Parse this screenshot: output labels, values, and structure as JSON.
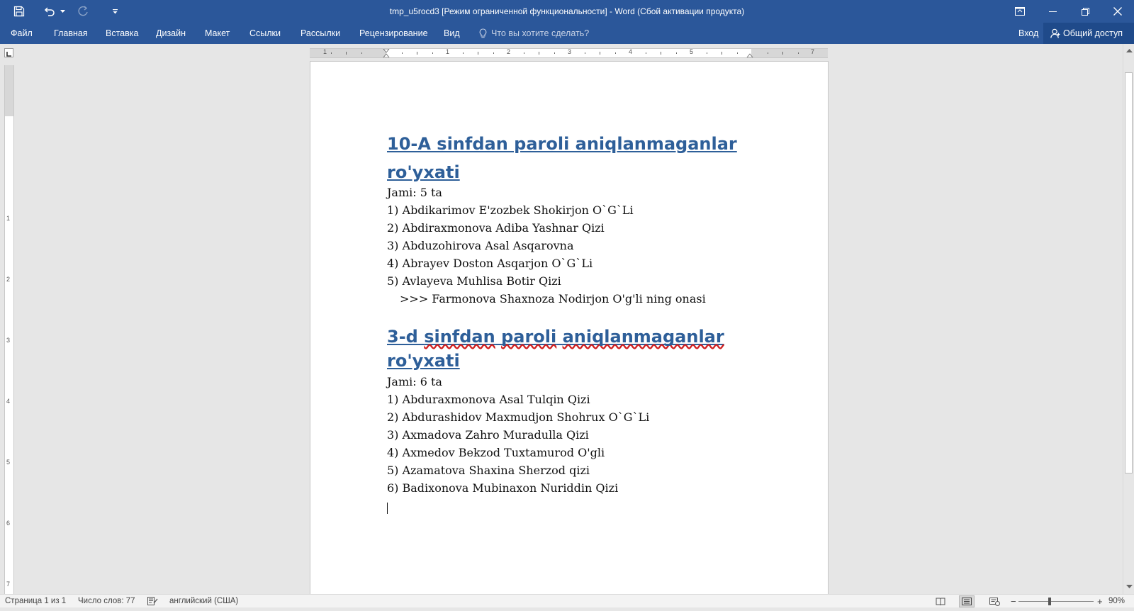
{
  "window": {
    "title": "tmp_u5rocd3 [Режим ограниченной функциональности] - Word (Сбой активации продукта)",
    "qat_icons": [
      "save-icon",
      "undo-icon",
      "redo-icon",
      "customize-qat-icon"
    ],
    "controls": [
      "ribbon-display-options-icon",
      "minimize-icon",
      "restore-icon",
      "close-icon"
    ]
  },
  "ribbon": {
    "tabs": [
      "Файл",
      "Главная",
      "Вставка",
      "Дизайн",
      "Макет",
      "Ссылки",
      "Рассылки",
      "Рецензирование",
      "Вид"
    ],
    "tell_me": "Что вы хотите сделать?",
    "login": "Вход",
    "share": "Общий доступ"
  },
  "ruler": {
    "h_numbers": [
      "1",
      "1",
      "2",
      "3",
      "4",
      "5",
      "7"
    ],
    "v_numbers": [
      "1",
      "2",
      "3",
      "4",
      "5",
      "6",
      "7"
    ]
  },
  "document": {
    "section1": {
      "heading_line1": "10-A sinfdan paroli aniqlanmaganlar",
      "heading_line2": "ro'yxati",
      "total": "Jami: 5 ta",
      "items": [
        "1) Abdikarimov E'zozbek Shokirjon O`G`Li",
        "2) Abdiraxmonova Adiba Yashnar Qizi",
        "3) Abduzohirova Asal Asqarovna",
        "4) Abrayev Doston Asqarjon O`G`Li",
        "5) Avlayeva Muhlisa Botir Qizi"
      ],
      "note": ">>> Farmonova Shaxnoza Nodirjon O'g'li ning onasi"
    },
    "section2": {
      "heading_parts": [
        "3-d ",
        "sinfdan",
        " ",
        "paroli",
        " ",
        "aniqlanmaganlar",
        " ro'yxati"
      ],
      "total": "Jami: 6 ta",
      "items": [
        "1) Abduraxmonova Asal Tulqin Qizi",
        "2) Abdurashidov Maxmudjon Shohrux O`G`Li",
        "3) Axmadova Zahro Muradulla Qizi",
        "4) Axmedov Bekzod Tuxtamurod O'gli",
        "5) Azamatova Shaxina Sherzod qizi",
        "6) Badixonova Mubinaxon Nuriddin Qizi"
      ]
    }
  },
  "status": {
    "page": "Страница 1 из 1",
    "words": "Число слов: 77",
    "language": "английский (США)",
    "zoom": "90%",
    "zoom_minus": "−",
    "zoom_plus": "+"
  },
  "colors": {
    "titlebar": "#2b579a",
    "heading": "#2e5f99",
    "spell_error": "#d12020"
  }
}
